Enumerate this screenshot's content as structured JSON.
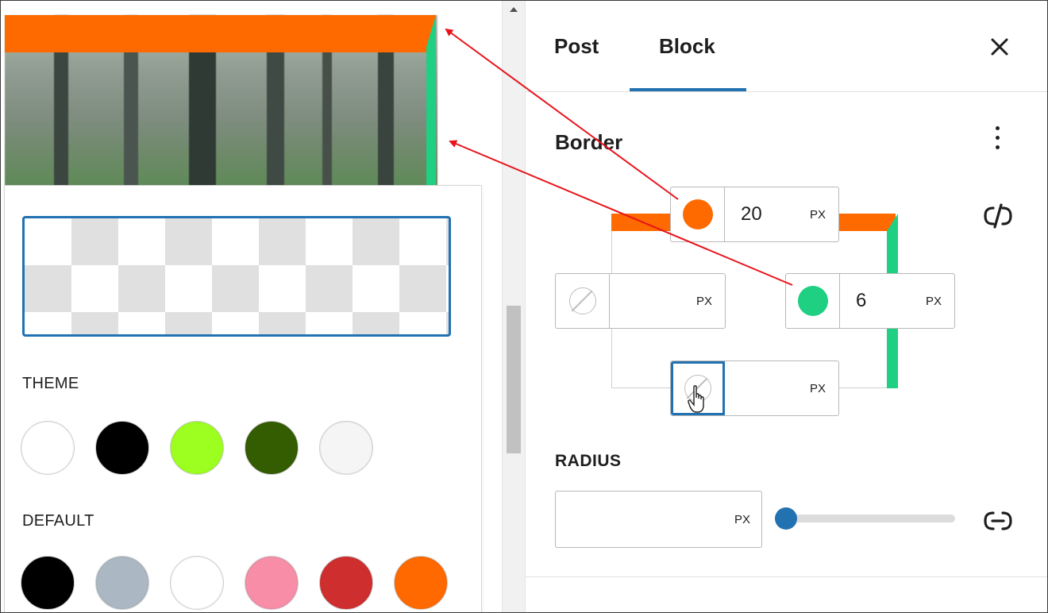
{
  "tabs": [
    {
      "label": "Post",
      "active": false
    },
    {
      "label": "Block",
      "active": true
    }
  ],
  "close_icon": "close-icon",
  "border_panel": {
    "title": "Border",
    "menu_icon": "more-vertical-icon",
    "link_icon": "unlink-icon",
    "top": {
      "color": "#ff6a00",
      "value": "20",
      "unit": "PX"
    },
    "right": {
      "color": "#1fcf82",
      "value": "6",
      "unit": "PX"
    },
    "left": {
      "color": null,
      "value": "",
      "unit": "PX"
    },
    "bottom": {
      "color": null,
      "value": "",
      "unit": "PX"
    }
  },
  "radius": {
    "label": "RADIUS",
    "value": "",
    "unit": "PX",
    "slider_value": 0,
    "link_icon": "link-icon"
  },
  "color_picker": {
    "theme_label": "THEME",
    "theme_colors": [
      "#ffffff",
      "#000000",
      "#9dff20",
      "#345c00",
      "#f5f5f5"
    ],
    "default_label": "DEFAULT",
    "default_colors": [
      "#000000",
      "#abb8c3",
      "#ffffff",
      "#f78da7",
      "#cf2e2e",
      "#ff6900"
    ]
  },
  "colors": {
    "accent": "#2271b1",
    "border_top": "#ff6a00",
    "border_right": "#1fcf82",
    "annotation_arrow": "#e8141b"
  }
}
